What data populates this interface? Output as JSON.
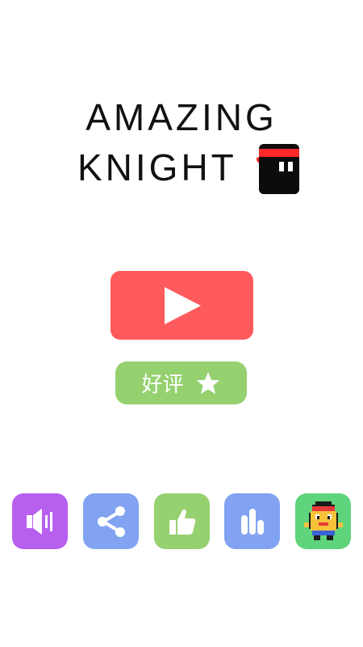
{
  "title": {
    "line1": "AMAZING",
    "line2": "KNIGHT"
  },
  "colors": {
    "play": "#fe5a5d",
    "rate": "#95d16f",
    "sound": "#b760f0",
    "share": "#82a3f2",
    "like": "#95d16f",
    "leaderboard": "#82a3f2",
    "character": "#5fd47c"
  },
  "rate_button": {
    "label": "好评",
    "icon": "star-icon"
  },
  "play_button": {
    "icon": "play-icon"
  },
  "bottom_icons": [
    {
      "name": "sound",
      "icon": "speaker-icon"
    },
    {
      "name": "share",
      "icon": "share-icon"
    },
    {
      "name": "like",
      "icon": "thumbs-up-icon"
    },
    {
      "name": "leaderboard",
      "icon": "bar-chart-icon"
    },
    {
      "name": "character",
      "icon": "character-icon"
    }
  ]
}
